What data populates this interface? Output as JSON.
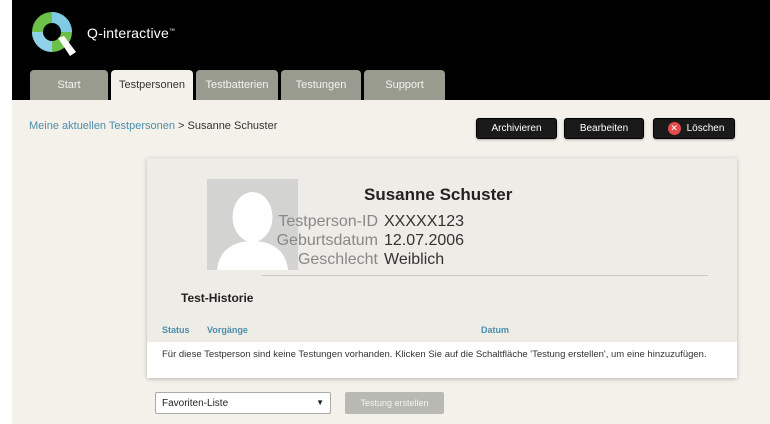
{
  "app": {
    "brand": "Q-interactive",
    "trademark": "™",
    "tabs": [
      "Start",
      "Testpersonen",
      "Testbatterien",
      "Testungen",
      "Support"
    ],
    "active_tab": "Testpersonen"
  },
  "breadcrumb": {
    "parent": "Meine aktuellen Testpersonen",
    "separator": " > ",
    "current": "Susanne Schuster"
  },
  "actions": {
    "archive": "Archivieren",
    "edit": "Bearbeiten",
    "delete": "Löschen"
  },
  "person": {
    "name": "Susanne Schuster",
    "fields": [
      {
        "label": "Testperson-ID",
        "value": "XXXXX123"
      },
      {
        "label": "Geburtsdatum",
        "value": "12.07.2006"
      },
      {
        "label": "Geschlecht",
        "value": "Weiblich"
      }
    ]
  },
  "history": {
    "title": "Test-Historie",
    "columns": [
      "Status",
      "Vorgänge",
      "Datum"
    ],
    "empty_message": "Für diese Testperson sind keine Testungen vorhanden. Klicken Sie auf die Schaltfläche 'Testung erstellen', um eine hinzuzufügen."
  },
  "bottom": {
    "select_value": "Favoriten-Liste",
    "create_button": "Testung erstellen"
  },
  "colors": {
    "header_bg": "#000000",
    "tab_bg": "#999b8f",
    "content_bg": "#f3f1ea",
    "link": "#4c8ea9",
    "delete_icon": "#e34a4a"
  }
}
